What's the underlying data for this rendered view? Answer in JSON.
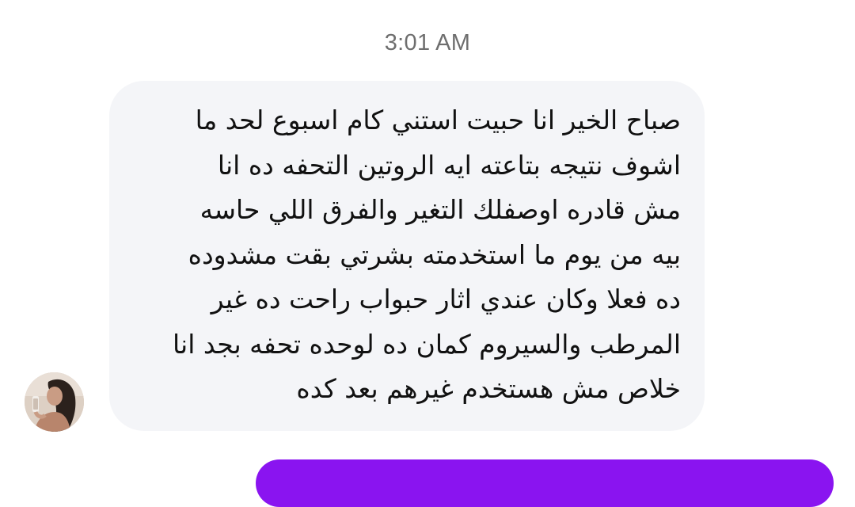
{
  "conversation": {
    "timestamp": "3:01 AM",
    "incoming_message": {
      "lines": [
        "صباح الخير انا حبيت استني كام اسبوع لحد ما",
        "اشوف نتيجه بتاعته ايه الروتين التحفه ده انا",
        "مش قادره اوصفلك التغير والفرق اللي حاسه",
        "بيه من يوم ما استخدمته بشرتي بقت مشدوده",
        "ده فعلا وكان عندي اثار حبواب راحت ده غير",
        "المرطب والسيروم كمان ده لوحده تحفه بجد انا",
        "خلاص مش هستخدم غيرهم بعد كده"
      ],
      "bubble_color": "#f4f5f8",
      "text_color": "#111111"
    },
    "sender_avatar_icon": "profile-photo-avatar",
    "outgoing_bubble_color": "#8a14f0"
  }
}
